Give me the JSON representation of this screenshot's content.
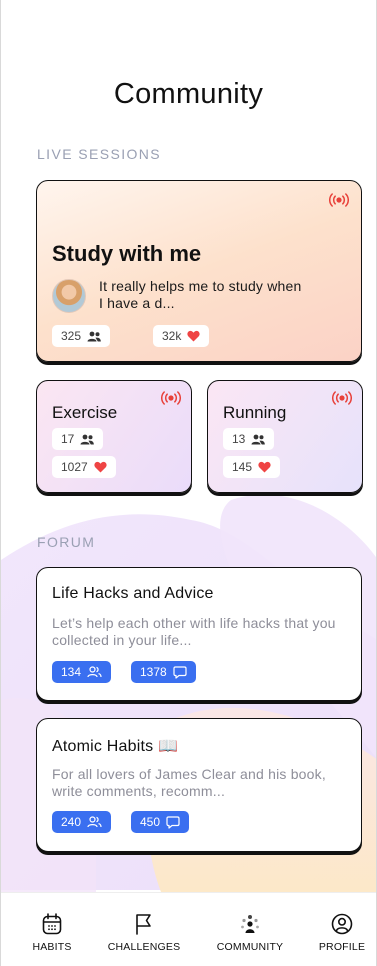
{
  "page": {
    "title": "Community"
  },
  "sections": {
    "live": "LIVE SESSIONS",
    "forum": "FORUM"
  },
  "live_sessions": {
    "featured": {
      "title": "Study with me",
      "description": "It really helps me to study when I have a d...",
      "participants": "325",
      "likes": "32k"
    },
    "exercise": {
      "title": "Exercise",
      "participants": "17",
      "likes": "1027"
    },
    "running": {
      "title": "Running",
      "participants": "13",
      "likes": "145"
    }
  },
  "forum": {
    "posts": [
      {
        "title": "Life Hacks and Advice",
        "description": "Let’s help each other with life hacks that you collected in your life...",
        "members": "134",
        "comments": "1378"
      },
      {
        "title": "Atomic Habits 📖",
        "description": "For all lovers of James Clear and his book, write comments, recomm...",
        "members": "240",
        "comments": "450"
      }
    ]
  },
  "nav": {
    "habits": "HABITS",
    "challenges": "CHALLENGES",
    "community": "COMMUNITY",
    "profile": "PROFILE"
  },
  "colors": {
    "accent_blue": "#3a6ff0",
    "live_red": "#e8413a",
    "heart_red": "#ef4444",
    "section_gray": "#9aa0b3"
  },
  "icons": [
    "live-broadcast-icon",
    "users-icon",
    "heart-icon",
    "comment-icon",
    "calendar-icon",
    "flag-icon",
    "community-dots-icon",
    "profile-icon"
  ]
}
